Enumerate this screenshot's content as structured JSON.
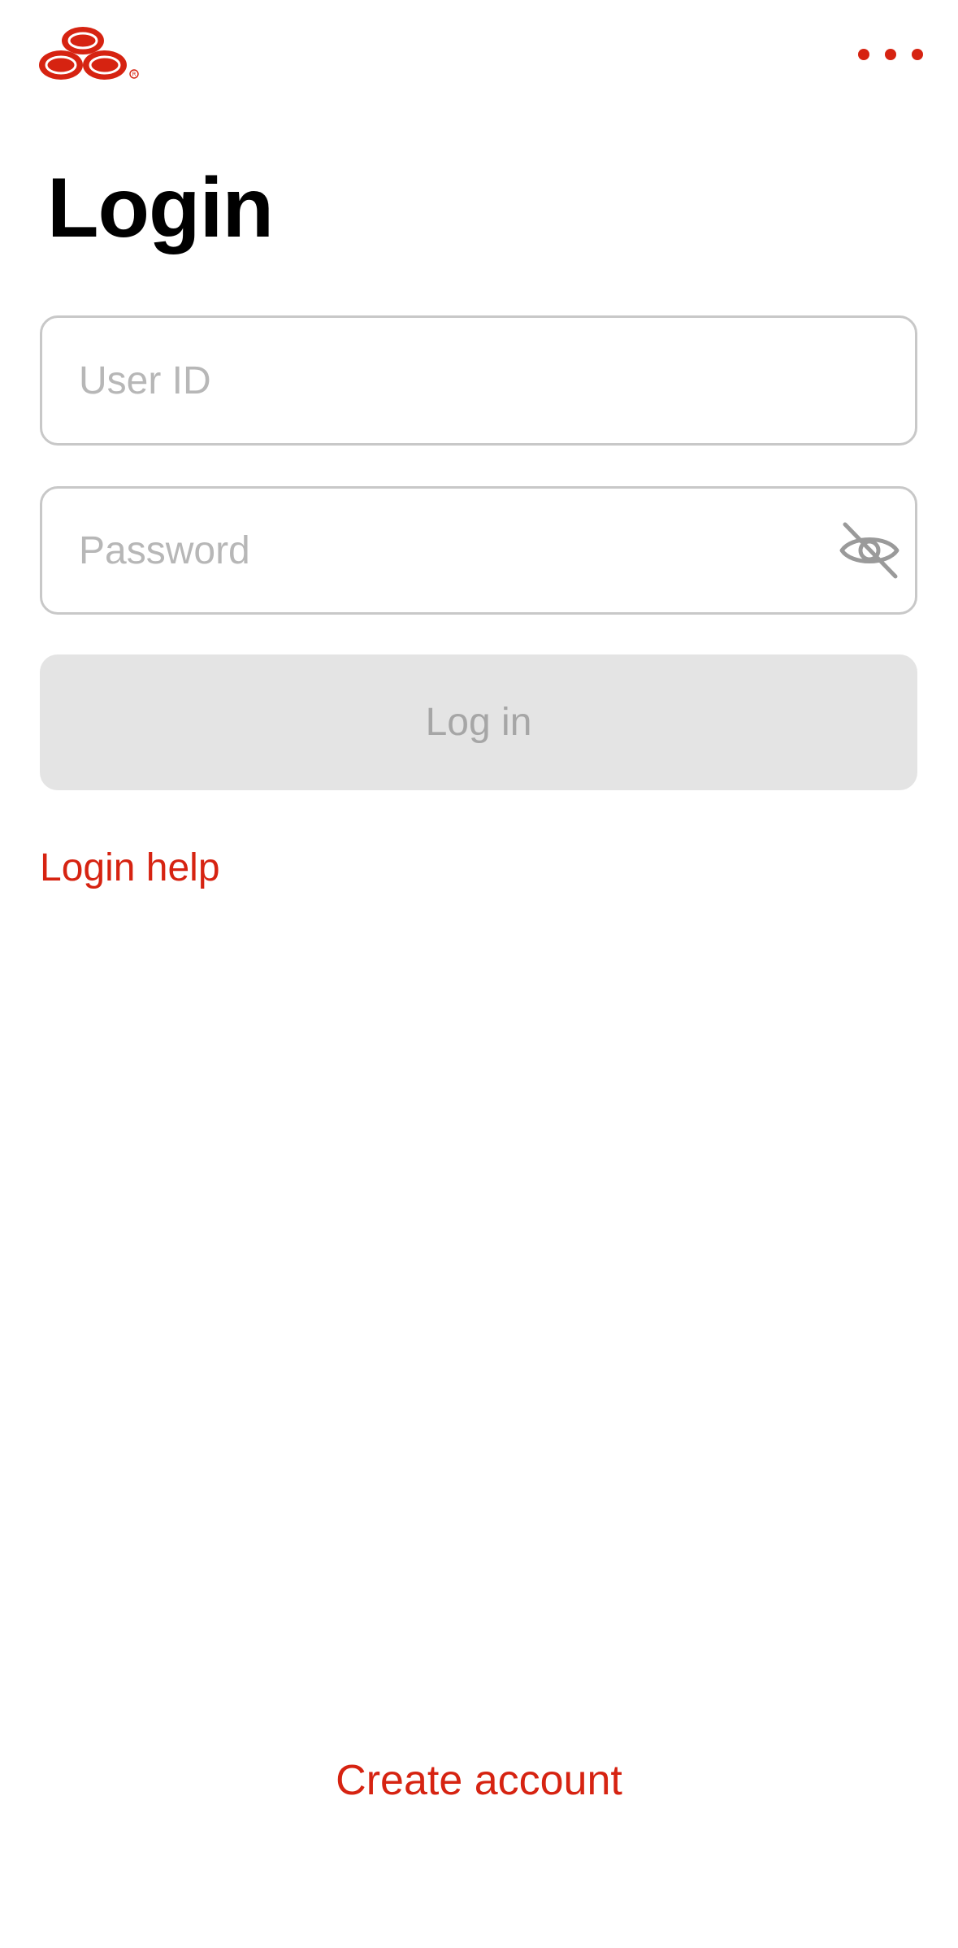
{
  "header": {
    "logo_icon": "state-farm-logo-icon",
    "more_icon": "more-horizontal-icon",
    "accent_color": "#d62311"
  },
  "page": {
    "title": "Login"
  },
  "form": {
    "user_id": {
      "value": "",
      "placeholder": "User ID"
    },
    "password": {
      "value": "",
      "placeholder": "Password",
      "toggle_icon": "eye-off-icon"
    },
    "login_button_label": "Log in",
    "login_button_state": "disabled",
    "login_help_label": "Login help"
  },
  "footer": {
    "create_account_label": "Create account"
  }
}
